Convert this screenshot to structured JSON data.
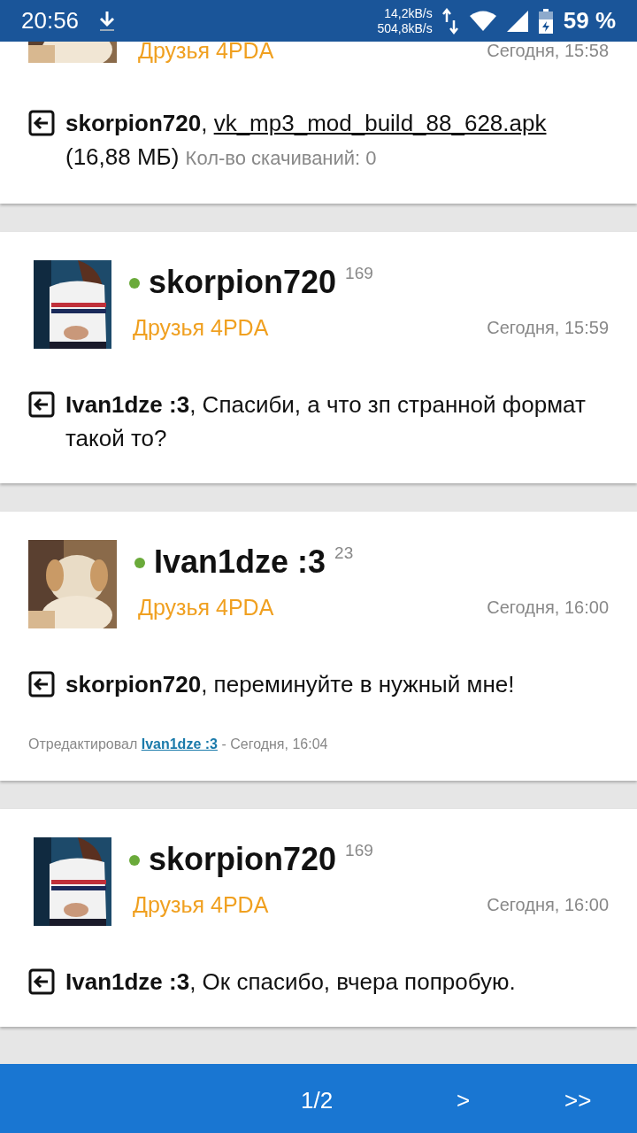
{
  "status_bar": {
    "time": "20:56",
    "upload_speed": "14,2kB/s",
    "download_speed": "504,8kB/s",
    "battery": "59 %"
  },
  "posts": [
    {
      "group": "Друзья 4PDA",
      "date": "Сегодня, 15:58",
      "text": "**skorpion720**,",
      "attachment": {
        "name": "vk_mp3_mod_build_88_628.apk",
        "size": "(16,88 МБ)",
        "downloads": "Кол-во скачиваний: 0"
      }
    },
    {
      "author": "skorpion720",
      "online": true,
      "reputation": "169",
      "group": "Друзья 4PDA",
      "date": "Сегодня, 15:59",
      "text": "**Ivan1dze :3**, Спасиби, а что зп странной формат такой то?"
    },
    {
      "author": "Ivan1dze :3",
      "online": true,
      "reputation": "23",
      "group": "Друзья 4PDA",
      "date": "Сегодня, 16:00",
      "text": "**skorpion720**, переминуйте в нужный мне!",
      "edited": {
        "prefix": "Отредактировал",
        "user": "Ivan1dze :3",
        "suffix": "- Сегодня, 16:04"
      }
    },
    {
      "author": "skorpion720",
      "online": true,
      "reputation": "169",
      "group": "Друзья 4PDA",
      "date": "Сегодня, 16:00",
      "text": "**Ivan1dze :3**, Ок спасибо, вчера попробую."
    }
  ],
  "pagination": {
    "page": "1/2",
    "next": ">",
    "last": ">>"
  }
}
